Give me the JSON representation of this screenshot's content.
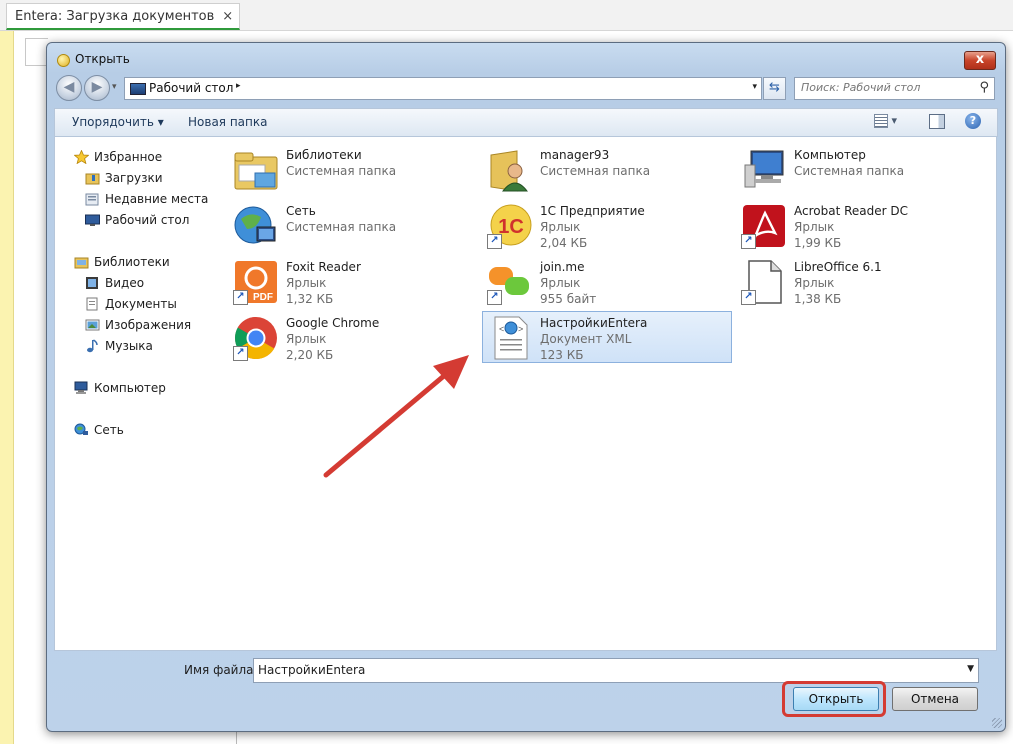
{
  "app": {
    "tab_title": "Entera: Загрузка документов",
    "tab_close": "×"
  },
  "dialog": {
    "title": "Открыть",
    "close_glyph": "x",
    "address": {
      "location": "Рабочий стол",
      "separator": "▸",
      "dropdown": "▾"
    },
    "search": {
      "placeholder": "Поиск: Рабочий стол",
      "value": ""
    },
    "toolbar": {
      "organize_label": "Упорядочить ▾",
      "new_folder_label": "Новая папка",
      "help_glyph": "?"
    },
    "nav": {
      "favorites_header": "Избранное",
      "favorites": [
        "Загрузки",
        "Недавние места",
        "Рабочий стол"
      ],
      "libraries_header": "Библиотеки",
      "libraries": [
        "Видео",
        "Документы",
        "Изображения",
        "Музыка"
      ],
      "computer": "Компьютер",
      "network": "Сеть"
    },
    "files": [
      {
        "name": "Библиотеки",
        "type": "Системная папка",
        "size": "",
        "icon": "libraries-icon"
      },
      {
        "name": "manager93",
        "type": "Системная папка",
        "size": "",
        "icon": "user-folder-icon"
      },
      {
        "name": "Компьютер",
        "type": "Системная папка",
        "size": "",
        "icon": "computer-icon"
      },
      {
        "name": "Сеть",
        "type": "Системная папка",
        "size": "",
        "icon": "network-icon"
      },
      {
        "name": "1С Предприятие",
        "type": "Ярлык",
        "size": "2,04 КБ",
        "icon": "1c-icon"
      },
      {
        "name": "Acrobat Reader DC",
        "type": "Ярлык",
        "size": "1,99 КБ",
        "icon": "acrobat-icon"
      },
      {
        "name": "Foxit Reader",
        "type": "Ярлык",
        "size": "1,32 КБ",
        "icon": "foxit-icon"
      },
      {
        "name": "join.me",
        "type": "Ярлык",
        "size": "955 байт",
        "icon": "joinme-icon"
      },
      {
        "name": "LibreOffice 6.1",
        "type": "Ярлык",
        "size": "1,38 КБ",
        "icon": "libreoffice-icon"
      },
      {
        "name": "Google Chrome",
        "type": "Ярлык",
        "size": "2,20 КБ",
        "icon": "chrome-icon"
      },
      {
        "name": "НастройкиEntera",
        "type": "Документ XML",
        "size": "123 КБ",
        "icon": "xml-document-icon",
        "selected": true
      }
    ],
    "filename": {
      "label": "Имя файла:",
      "value": "НастройкиEntera"
    },
    "open_label": "Открыть",
    "cancel_label": "Отмена"
  },
  "colors": {
    "highlight": "#d43b33",
    "arrow": "#d43b33",
    "selection": "#cfe2f8"
  }
}
